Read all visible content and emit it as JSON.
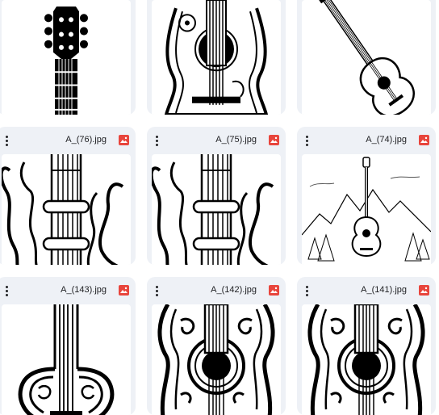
{
  "files": [
    {
      "name": ""
    },
    {
      "name": ""
    },
    {
      "name": ""
    },
    {
      "name": "A_(76).jpg"
    },
    {
      "name": "A_(75).jpg"
    },
    {
      "name": "A_(74).jpg"
    },
    {
      "name": "A_(143).jpg"
    },
    {
      "name": "A_(142).jpg"
    },
    {
      "name": "A_(141).jpg"
    }
  ],
  "colors": {
    "card_bg": "#eef1f6",
    "image_icon": "#e8453c"
  }
}
